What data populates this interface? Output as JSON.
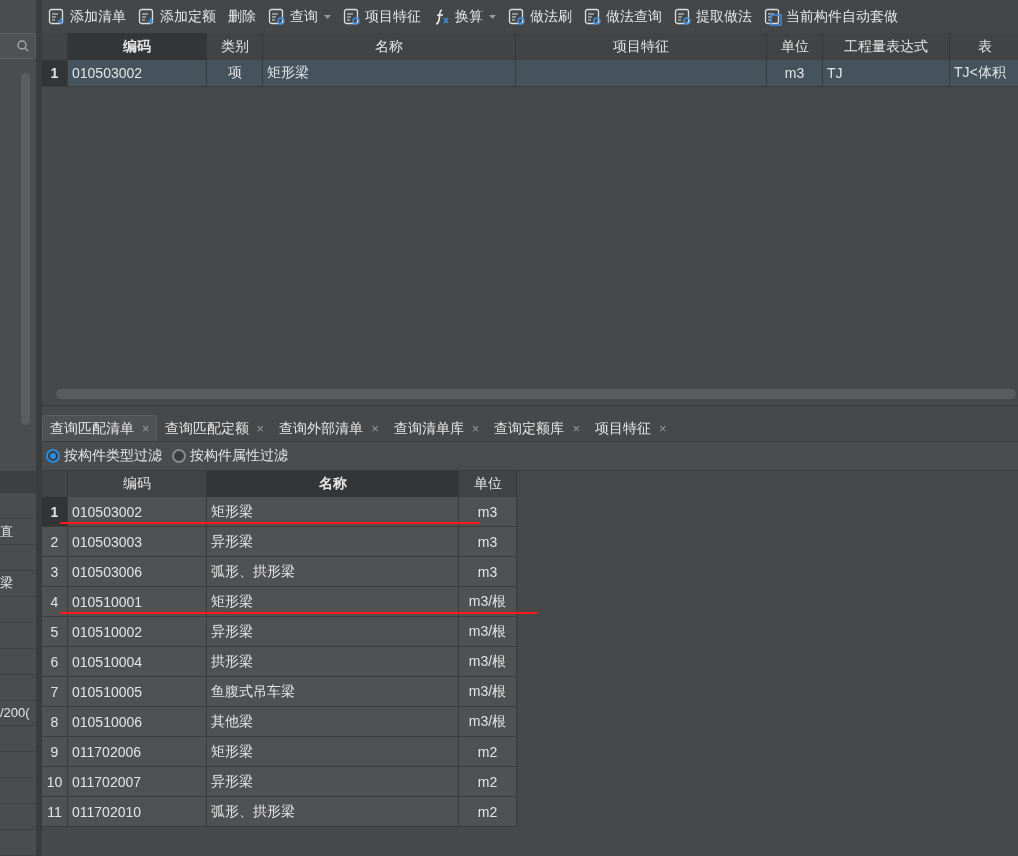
{
  "left_panel": {
    "rows": [
      {},
      {
        "value": "直"
      },
      {},
      {
        "value": "梁"
      },
      {},
      {},
      {},
      {},
      {
        "value": "/200("
      },
      {},
      {},
      {},
      {},
      {}
    ]
  },
  "toolbar": [
    {
      "label": "添加清单",
      "dropdown": false
    },
    {
      "label": "添加定额",
      "dropdown": false
    },
    {
      "label": "删除",
      "dropdown": false
    },
    {
      "label": "查询",
      "dropdown": true
    },
    {
      "label": "项目特征",
      "dropdown": false
    },
    {
      "label": "换算",
      "dropdown": true
    },
    {
      "label": "做法刷",
      "dropdown": false
    },
    {
      "label": "做法查询",
      "dropdown": false
    },
    {
      "label": "提取做法",
      "dropdown": false
    },
    {
      "label": "当前构件自动套做",
      "dropdown": false
    }
  ],
  "top_table": {
    "columns": [
      {
        "label": "编码",
        "selected": true
      },
      {
        "label": "类别",
        "selected": false
      },
      {
        "label": "名称",
        "selected": false
      },
      {
        "label": "项目特征",
        "selected": false
      },
      {
        "label": "单位",
        "selected": false
      },
      {
        "label": "工程量表达式",
        "selected": false
      },
      {
        "label": "表",
        "selected": false
      }
    ],
    "rows": [
      {
        "num": "1",
        "selected": true,
        "cells": [
          "010503002",
          "项",
          "矩形梁",
          "",
          "m3",
          "TJ",
          "TJ<体积"
        ]
      }
    ]
  },
  "tabs": [
    {
      "label": "查询匹配清单",
      "close": "×",
      "selected": true
    },
    {
      "label": "查询匹配定额",
      "close": "×",
      "selected": false
    },
    {
      "label": "查询外部清单",
      "close": "×",
      "selected": false
    },
    {
      "label": "查询清单库",
      "close": "×",
      "selected": false
    },
    {
      "label": "查询定额库",
      "close": "×",
      "selected": false
    },
    {
      "label": "项目特征",
      "close": "×",
      "selected": false
    }
  ],
  "filters": [
    {
      "label": "按构件类型过滤",
      "selected": true
    },
    {
      "label": "按构件属性过滤",
      "selected": false
    }
  ],
  "match_table": {
    "columns": [
      {
        "label": "编码",
        "selected": false
      },
      {
        "label": "名称",
        "selected": true
      },
      {
        "label": "单位",
        "selected": false
      }
    ],
    "rows": [
      {
        "num": "1",
        "code": "010503002",
        "name": "矩形梁",
        "unit": "m3",
        "selected": true,
        "underlined": true
      },
      {
        "num": "2",
        "code": "010503003",
        "name": "异形梁",
        "unit": "m3",
        "selected": false,
        "underlined": false
      },
      {
        "num": "3",
        "code": "010503006",
        "name": "弧形、拱形梁",
        "unit": "m3",
        "selected": false,
        "underlined": false
      },
      {
        "num": "4",
        "code": "010510001",
        "name": "矩形梁",
        "unit": "m3/根",
        "selected": false,
        "underlined": true
      },
      {
        "num": "5",
        "code": "010510002",
        "name": "异形梁",
        "unit": "m3/根",
        "selected": false,
        "underlined": false
      },
      {
        "num": "6",
        "code": "010510004",
        "name": "拱形梁",
        "unit": "m3/根",
        "selected": false,
        "underlined": false
      },
      {
        "num": "7",
        "code": "010510005",
        "name": "鱼腹式吊车梁",
        "unit": "m3/根",
        "selected": false,
        "underlined": false
      },
      {
        "num": "8",
        "code": "010510006",
        "name": "其他梁",
        "unit": "m3/根",
        "selected": false,
        "underlined": false
      },
      {
        "num": "9",
        "code": "011702006",
        "name": "矩形梁",
        "unit": "m2",
        "selected": false,
        "underlined": false
      },
      {
        "num": "10",
        "code": "011702007",
        "name": "异形梁",
        "unit": "m2",
        "selected": false,
        "underlined": false
      },
      {
        "num": "11",
        "code": "011702010",
        "name": "弧形、拱形梁",
        "unit": "m2",
        "selected": false,
        "underlined": false
      }
    ]
  }
}
